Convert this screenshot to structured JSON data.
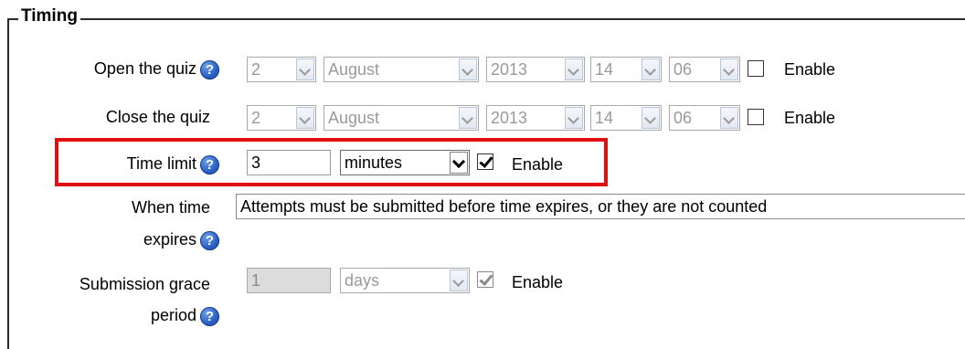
{
  "legend": "Timing",
  "open_quiz": {
    "label": "Open the quiz",
    "day": "2",
    "month": "August",
    "year": "2013",
    "hour": "14",
    "minute": "06",
    "enable_label": "Enable"
  },
  "close_quiz": {
    "label": "Close the quiz",
    "day": "2",
    "month": "August",
    "year": "2013",
    "hour": "14",
    "minute": "06",
    "enable_label": "Enable"
  },
  "time_limit": {
    "label": "Time limit",
    "value": "3",
    "unit": "minutes",
    "enable_label": "Enable",
    "enabled": true
  },
  "when_expires": {
    "label_line1": "When time",
    "label_line2": "expires",
    "value": "Attempts must be submitted before time expires, or they are not counted"
  },
  "grace_period": {
    "label_line1": "Submission grace",
    "label_line2": "period",
    "value": "1",
    "unit": "days",
    "enable_label": "Enable",
    "enabled": true
  },
  "icons": {
    "help": "help-icon",
    "dropdown": "chevron-down-icon"
  },
  "colors": {
    "highlight": "#e01010",
    "help_icon": "#2c63c8"
  }
}
